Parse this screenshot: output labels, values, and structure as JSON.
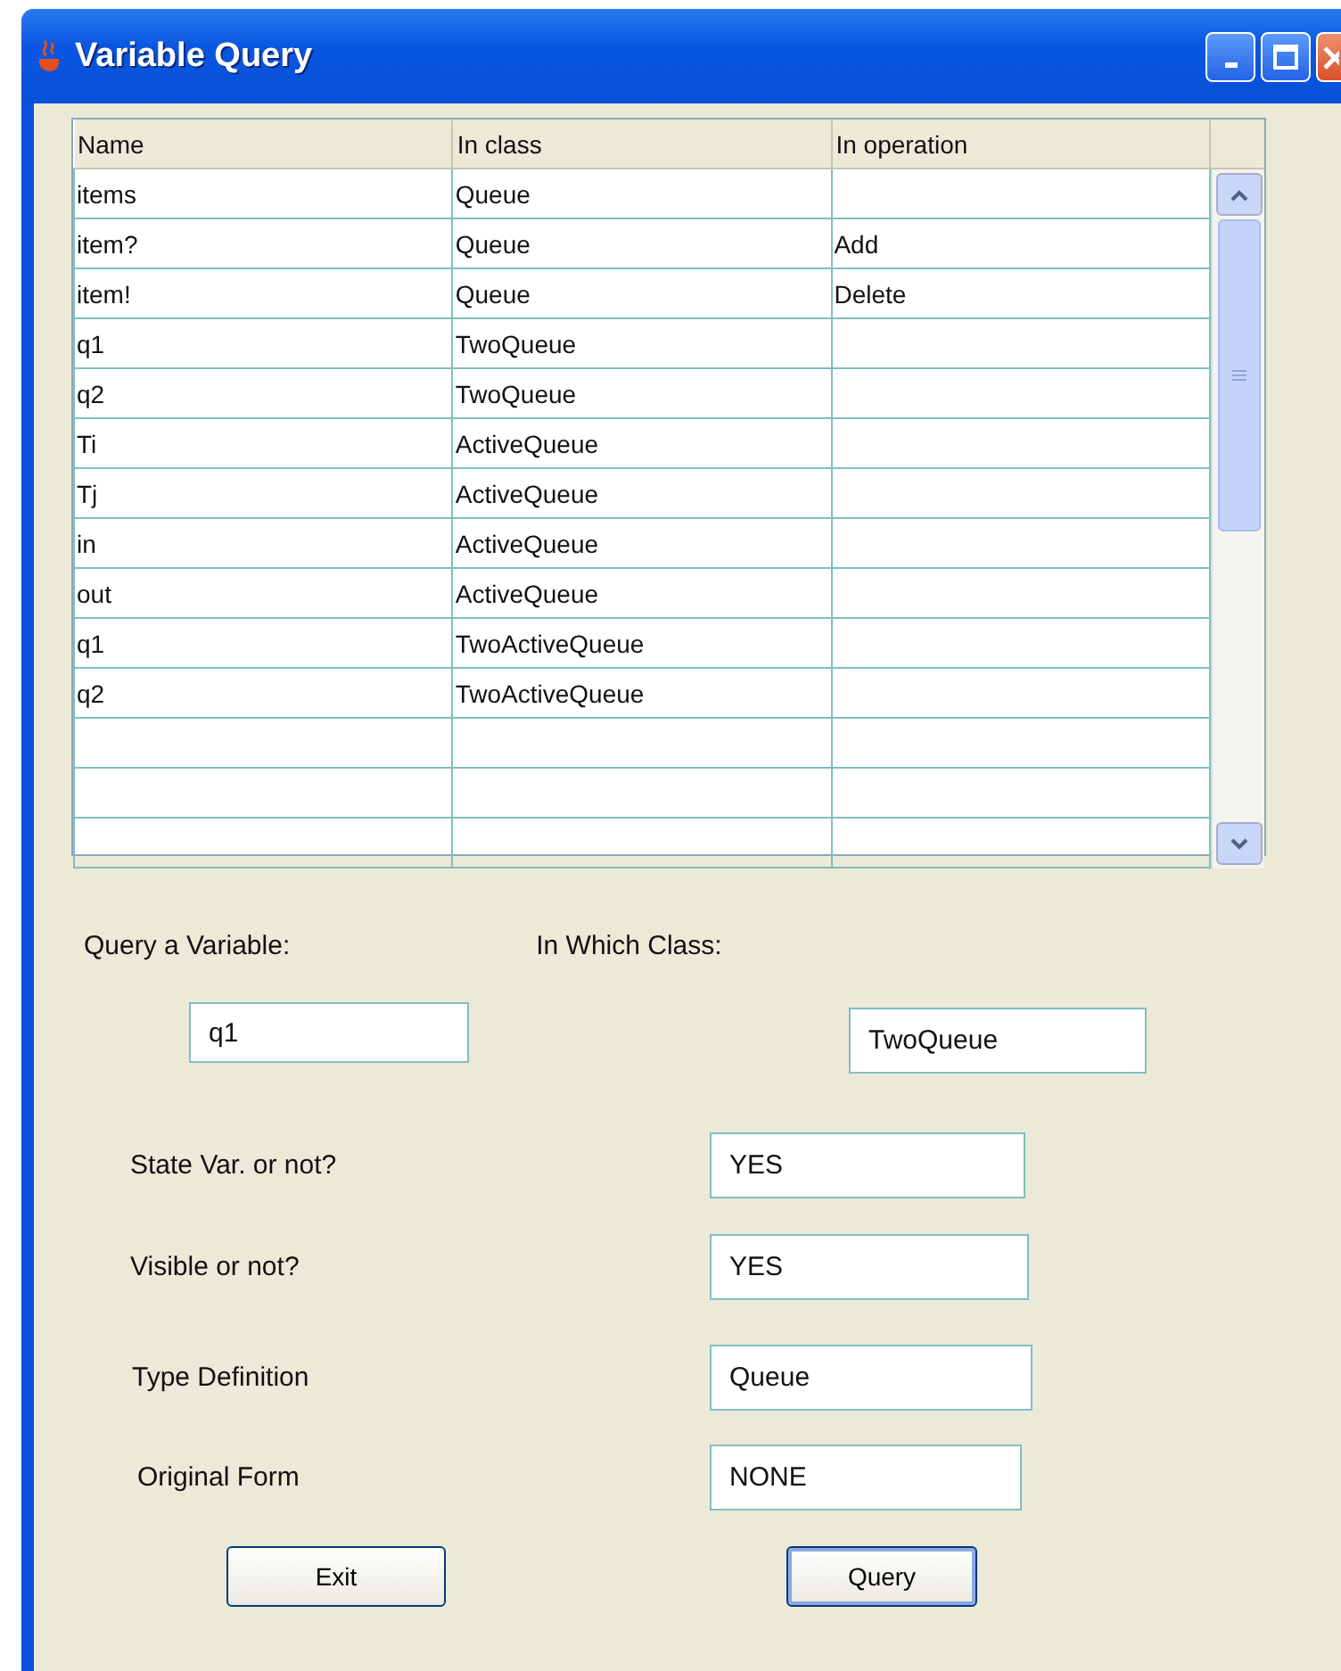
{
  "window": {
    "title": "Variable Query"
  },
  "table": {
    "columns": [
      "Name",
      "In class",
      "In operation"
    ],
    "rows": [
      [
        "items",
        "Queue",
        ""
      ],
      [
        "item?",
        "Queue",
        "Add"
      ],
      [
        "item!",
        "Queue",
        "Delete"
      ],
      [
        "q1",
        "TwoQueue",
        ""
      ],
      [
        "q2",
        "TwoQueue",
        ""
      ],
      [
        "Ti",
        "ActiveQueue",
        ""
      ],
      [
        "Tj",
        "ActiveQueue",
        ""
      ],
      [
        "in",
        "ActiveQueue",
        ""
      ],
      [
        "out",
        "ActiveQueue",
        ""
      ],
      [
        "q1",
        "TwoActiveQueue",
        ""
      ],
      [
        "q2",
        "TwoActiveQueue",
        ""
      ]
    ]
  },
  "query": {
    "variable_label": "Query a Variable:",
    "variable_value": "q1",
    "class_label": "In Which Class:",
    "class_value": "TwoQueue"
  },
  "results": [
    {
      "label": "State Var. or not?",
      "value": "YES"
    },
    {
      "label": "Visible or not?",
      "value": "YES"
    },
    {
      "label": "Type Definition",
      "value": "Queue"
    },
    {
      "label": "Original Form",
      "value": "NONE"
    }
  ],
  "buttons": [
    {
      "label": "Exit",
      "focused": false
    },
    {
      "label": "Query",
      "focused": true
    }
  ]
}
